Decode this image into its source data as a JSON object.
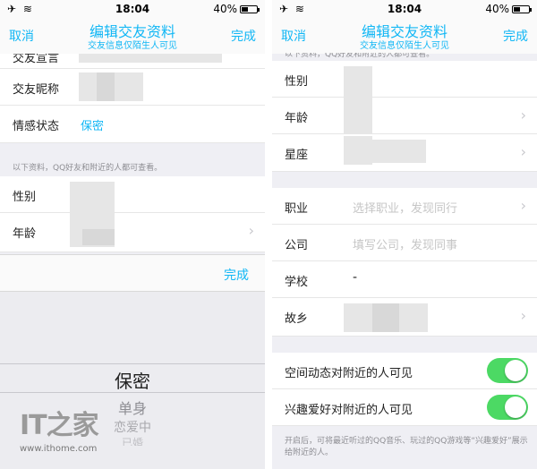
{
  "status_bar": {
    "left_icons": "✈ ≋",
    "time": "18:04",
    "battery": "40%"
  },
  "navbar": {
    "cancel": "取消",
    "title": "编辑交友资料",
    "subtitle": "交友信息仅陌生人可见",
    "done": "完成"
  },
  "left": {
    "rows": {
      "top_partial": "交友宣言",
      "nickname": "交友昵称",
      "relationship": "情感状态",
      "relationship_value": "保密",
      "gender": "性别",
      "age": "年龄"
    },
    "section_note": "以下资料，QQ好友和附近的人都可查看。",
    "picker": {
      "done": "完成",
      "options": [
        "保密",
        "单身",
        "恋爱中",
        "已婚"
      ],
      "selected": "保密"
    }
  },
  "right": {
    "top_note": "以下资料，QQ好友和附近的人都可查看。",
    "rows": {
      "gender": "性别",
      "age": "年龄",
      "zodiac": "星座",
      "job": "职业",
      "job_placeholder": "选择职业，发现同行",
      "company": "公司",
      "company_placeholder": "填写公司，发现同事",
      "school": "学校",
      "school_value": "-",
      "hometown": "故乡"
    },
    "toggles": {
      "space": "空间动态对附近的人可见",
      "interest": "兴趣爱好对附近的人可见",
      "space_on": true,
      "interest_on": true
    },
    "footer": "开启后，可将最近听过的QQ音乐、玩过的QQ游戏等“兴趣爱好”展示给附近的人。"
  },
  "watermark": {
    "url": "www.ithome.com"
  },
  "colors": {
    "accent": "#12b7f5",
    "toggle_on": "#4cd964",
    "background": "#efeff4"
  }
}
